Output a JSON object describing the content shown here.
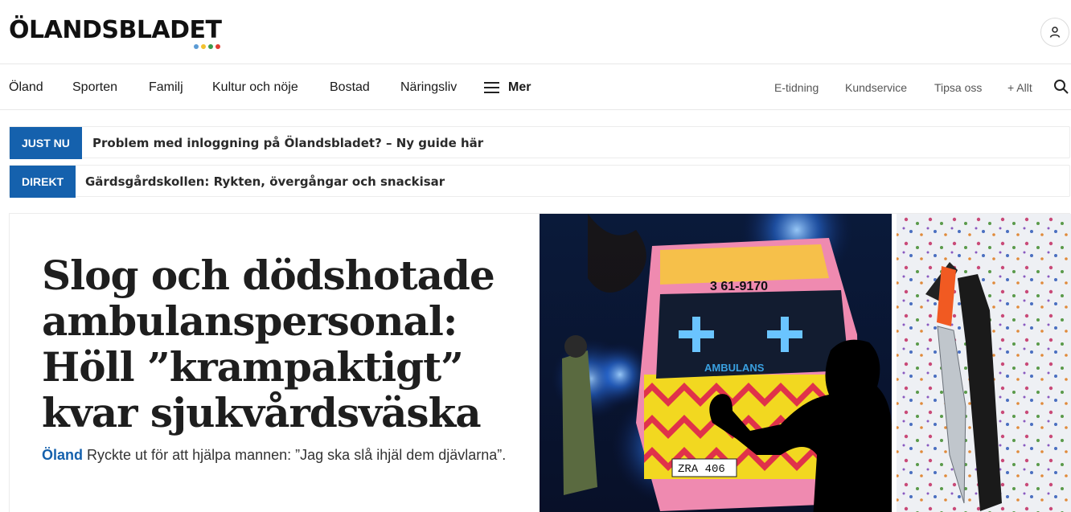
{
  "header": {
    "logo_text": "ÖLANDSBLADET",
    "logo_dot_colors": [
      "#5b9bd5",
      "#f2c12e",
      "#3a9a4c",
      "#e03c31"
    ],
    "user_icon": "user-icon"
  },
  "nav": {
    "items": [
      "Öland",
      "Sporten",
      "Familj",
      "Kultur och nöje",
      "Bostad",
      "Näringsliv"
    ],
    "more_label": "Mer",
    "right_links": [
      "E-tidning",
      "Kundservice",
      "Tipsa oss",
      "+ Allt"
    ],
    "search_icon": "search-icon"
  },
  "ticker": [
    {
      "tag": "JUST NU",
      "text": "Problem med inloggning på Ölandsbladet? – Ny guide här"
    },
    {
      "tag": "DIREKT",
      "text": "Gärdsgårdskollen: Rykten, övergångar och snackisar"
    }
  ],
  "lead_story": {
    "headline": "Slog och dödshotade ambulanspersonal: Höll ”krampaktigt” kvar sjukvårdsväska",
    "section": "Öland",
    "summary": "Ryckte ut för att hjälpa mannen: ”Jag ska slå ihjäl dem djävlarna”.",
    "image_texts": {
      "vehicle_number": "3 61-9170",
      "vehicle_label": "AMBULANS",
      "plate": "ZRA 406"
    }
  },
  "colors": {
    "accent": "#1561ad",
    "text": "#1e1e1e"
  }
}
